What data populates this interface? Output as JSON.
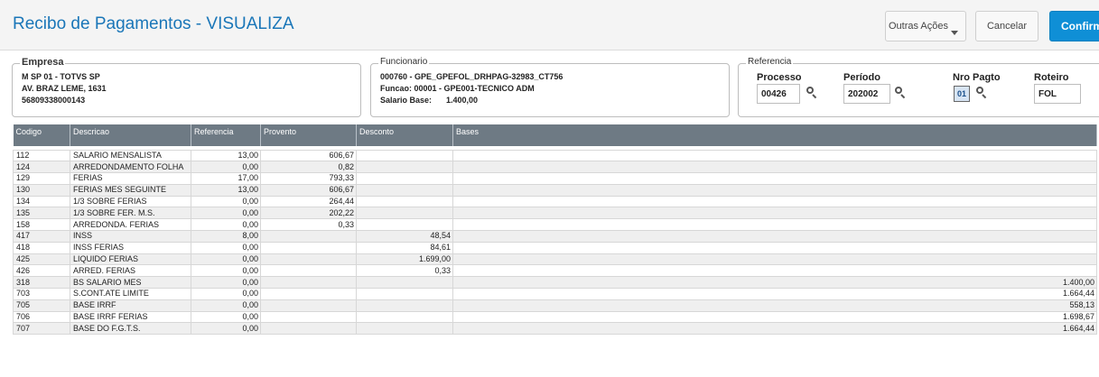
{
  "header": {
    "title": "Recibo de Pagamentos - VISUALIZA",
    "buttons": {
      "outras": "Outras Ações",
      "cancelar": "Cancelar",
      "confirmar": "Confirmar"
    }
  },
  "empresa": {
    "legend": "Empresa",
    "line1": "M SP 01  - TOTVS SP",
    "line2": "AV. BRAZ LEME, 1631",
    "line3": "56809338000143"
  },
  "funcionario": {
    "legend": "Funcionario",
    "line1": "000760 - GPE_GPEFOL_DRHPAG-32983_CT756",
    "line2": "Funcao: 00001  - GPE001-TECNICO ADM",
    "salario_label": "Salario Base:",
    "salario_value": "1.400,00"
  },
  "referencia": {
    "legend": "Referencia",
    "processo_label": "Processo",
    "processo_value": "00426",
    "periodo_label": "Período",
    "periodo_value": "202002",
    "nro_pagto_label": "Nro Pagto",
    "nro_pagto_value": "01",
    "roteiro_label": "Roteiro",
    "roteiro_value": "FOL"
  },
  "table": {
    "columns": [
      "Codigo",
      "Descricao",
      "Referencia",
      "Provento",
      "Desconto",
      "Bases"
    ],
    "rows": [
      [
        "112",
        "SALARIO MENSALISTA",
        "13,00",
        "606,67",
        "",
        ""
      ],
      [
        "124",
        "ARREDONDAMENTO FOLHA",
        "0,00",
        "0,82",
        "",
        ""
      ],
      [
        "129",
        "FERIAS",
        "17,00",
        "793,33",
        "",
        ""
      ],
      [
        "130",
        "FERIAS MES SEGUINTE",
        "13,00",
        "606,67",
        "",
        ""
      ],
      [
        "134",
        "1/3 SOBRE FERIAS",
        "0,00",
        "264,44",
        "",
        ""
      ],
      [
        "135",
        "1/3 SOBRE FER. M.S.",
        "0,00",
        "202,22",
        "",
        ""
      ],
      [
        "158",
        "ARREDONDA. FERIAS",
        "0,00",
        "0,33",
        "",
        ""
      ],
      [
        "417",
        "INSS",
        "8,00",
        "",
        "48,54",
        ""
      ],
      [
        "418",
        "INSS FERIAS",
        "0,00",
        "",
        "84,61",
        ""
      ],
      [
        "425",
        "LIQUIDO FERIAS",
        "0,00",
        "",
        "1.699,00",
        ""
      ],
      [
        "426",
        "ARRED. FERIAS",
        "0,00",
        "",
        "0,33",
        ""
      ],
      [
        "318",
        "BS SALARIO MES",
        "0,00",
        "",
        "",
        "1.400,00"
      ],
      [
        "703",
        "S.CONT.ATE LIMITE",
        "0,00",
        "",
        "",
        "1.664,44"
      ],
      [
        "705",
        "BASE IRRF",
        "0,00",
        "",
        "",
        "558,13"
      ],
      [
        "706",
        "BASE IRRF FERIAS",
        "0,00",
        "",
        "",
        "1.698,67"
      ],
      [
        "707",
        "BASE DO F.G.T.S.",
        "0,00",
        "",
        "",
        "1.664,44"
      ]
    ]
  },
  "icons": {
    "lookup": "magnifier-icon",
    "dropdown": "caret-down-icon"
  }
}
